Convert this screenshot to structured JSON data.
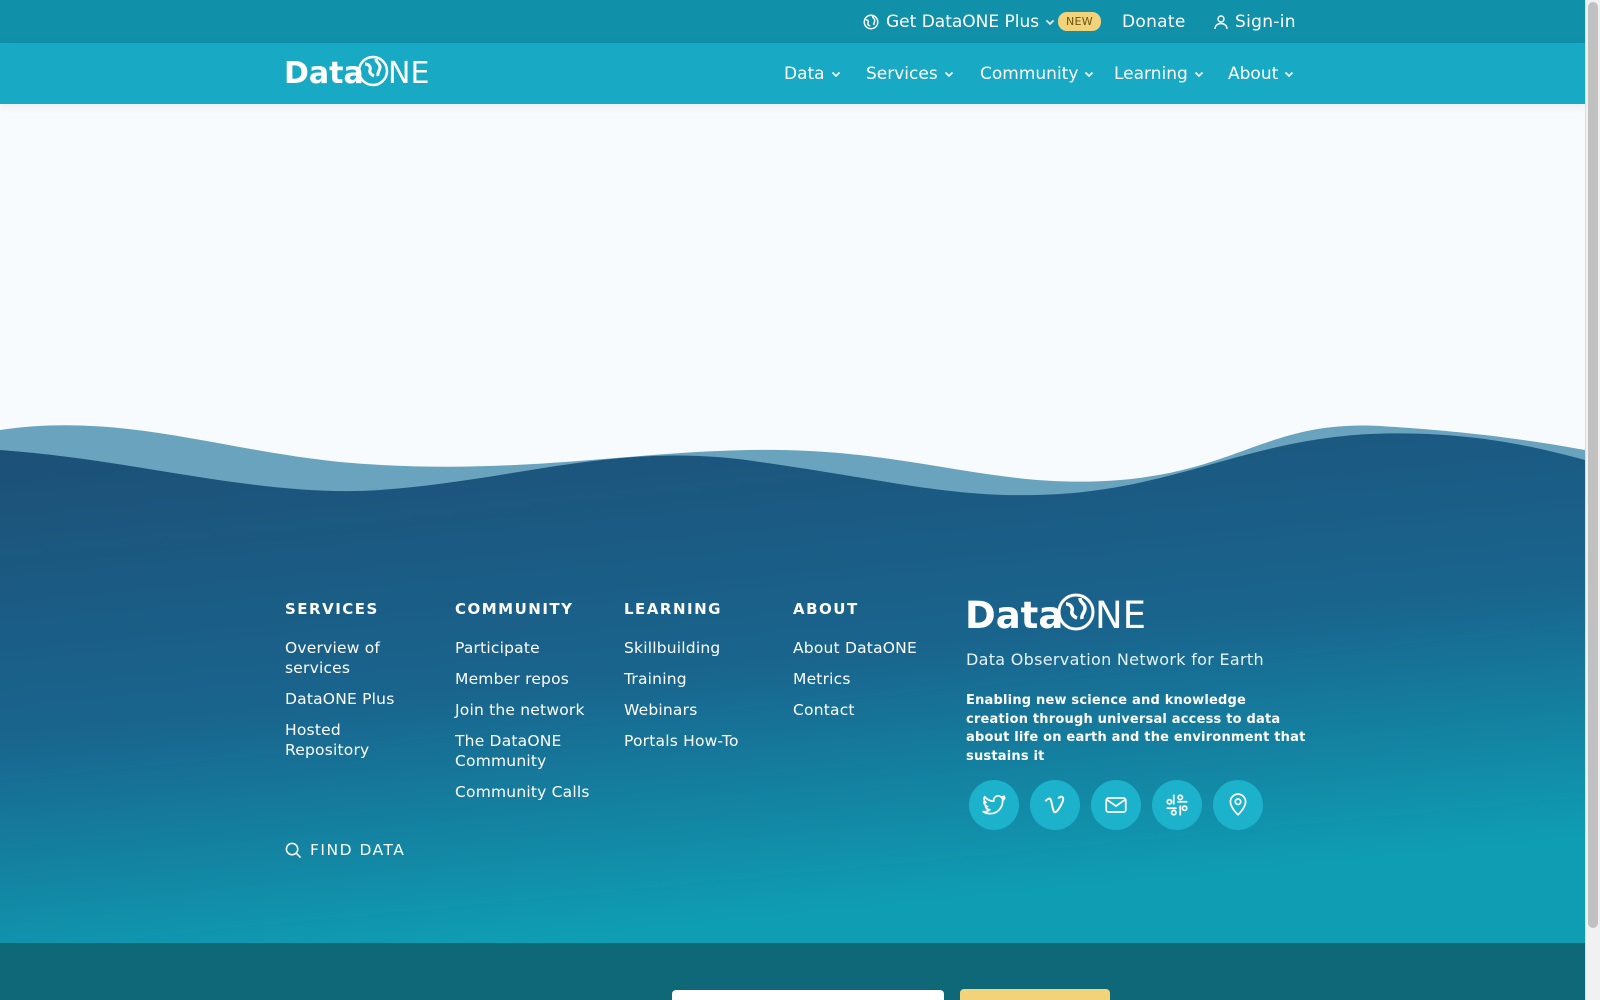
{
  "topbar": {
    "plus_label": "Get DataONE Plus",
    "new_badge": "NEW",
    "donate_label": "Donate",
    "signin_label": "Sign-in"
  },
  "nav": {
    "logo_text": "DataONE",
    "items": [
      "Data",
      "Services",
      "Community",
      "Learning",
      "About"
    ]
  },
  "footer": {
    "columns": [
      {
        "heading": "SERVICES",
        "links": [
          "Overview of services",
          "DataONE Plus",
          "Hosted Repository"
        ]
      },
      {
        "heading": "COMMUNITY",
        "links": [
          "Participate",
          "Member repos",
          "Join the network",
          "The DataONE Community",
          "Community Calls"
        ]
      },
      {
        "heading": "LEARNING",
        "links": [
          "Skillbuilding",
          "Training",
          "Webinars",
          "Portals How-To"
        ]
      },
      {
        "heading": "ABOUT",
        "links": [
          "About DataONE",
          "Metrics",
          "Contact"
        ]
      }
    ],
    "find_data_label": "FIND DATA",
    "logo_text": "DataONE",
    "tagline": "Data Observation Network for Earth",
    "mission": "Enabling new science and knowledge creation through universal access to data about life on earth and the environment that sustains it",
    "social_icons": [
      "twitter-icon",
      "vimeo-icon",
      "email-icon",
      "slack-icon",
      "location-icon"
    ]
  },
  "colors": {
    "topbar": "#1191a9",
    "navbar": "#18a9c4",
    "footer_dark": "#1d4f76",
    "wave_light": "#6aa3be",
    "accent_yellow": "#f3d37a",
    "social_circle": "#1db2cb"
  }
}
